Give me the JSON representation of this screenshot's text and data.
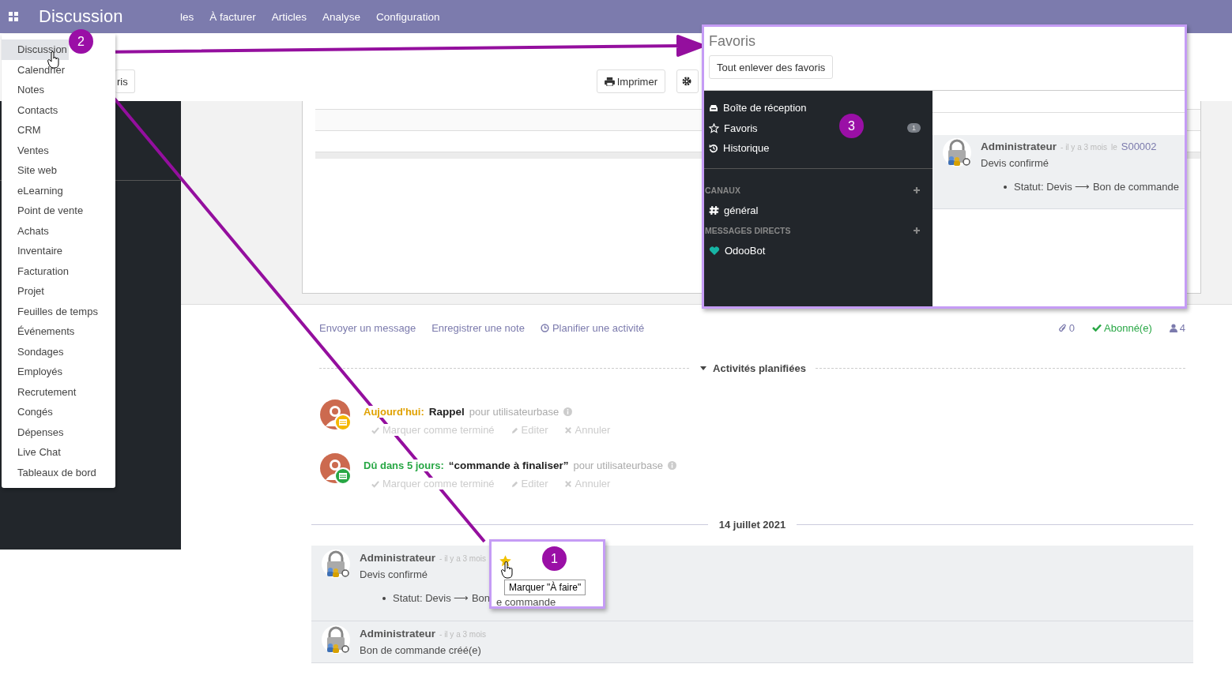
{
  "navbar": {
    "title": "Discussion",
    "menu": [
      "les",
      "À facturer",
      "Articles",
      "Analyse",
      "Configuration"
    ]
  },
  "control_panel": {
    "buttons": [
      {
        "kind": "plain",
        "label": "ris"
      },
      {
        "kind": "print",
        "label": "Imprimer"
      },
      {
        "kind": "gear"
      }
    ]
  },
  "app_menu": {
    "items": [
      {
        "label": "Discussion",
        "selected": true
      },
      {
        "label": "Calendrier",
        "selected": false
      },
      {
        "label": "Notes",
        "selected": false
      },
      {
        "label": "Contacts",
        "selected": false
      },
      {
        "label": "CRM",
        "selected": false
      },
      {
        "label": "Ventes",
        "selected": false
      },
      {
        "label": "Site web",
        "selected": false
      },
      {
        "label": "eLearning",
        "selected": false
      },
      {
        "label": "Point de vente",
        "selected": false
      },
      {
        "label": "Achats",
        "selected": false
      },
      {
        "label": "Inventaire",
        "selected": false
      },
      {
        "label": "Facturation",
        "selected": false
      },
      {
        "label": "Projet",
        "selected": false
      },
      {
        "label": "Feuilles de temps",
        "selected": false
      },
      {
        "label": "Événements",
        "selected": false
      },
      {
        "label": "Sondages",
        "selected": false
      },
      {
        "label": "Employés",
        "selected": false
      },
      {
        "label": "Recrutement",
        "selected": false
      },
      {
        "label": "Congés",
        "selected": false
      },
      {
        "label": "Dépenses",
        "selected": false
      },
      {
        "label": "Live Chat",
        "selected": false
      },
      {
        "label": "Tableaux de bord",
        "selected": false
      }
    ]
  },
  "chatter": {
    "actions": [
      {
        "kind": "link",
        "label": "Envoyer un message"
      },
      {
        "kind": "link",
        "label": "Enregistrer une note"
      },
      {
        "kind": "clock",
        "label": "Planifier une activité"
      }
    ],
    "attachments": "0",
    "follow": "Abonné(e)",
    "followers": "4",
    "activities_title": "Activités planifiées",
    "activities": [
      {
        "kind": "today",
        "due": "Aujourd'hui:",
        "summary": "Rappel",
        "assignee": "pour utilisateurbase",
        "actions": [
          "Marquer comme terminé",
          "Editer",
          "Annuler"
        ]
      },
      {
        "kind": "planned",
        "due": "Dû dans 5 jours:",
        "summary": "“commande à finaliser”",
        "assignee": "pour utilisateurbase",
        "actions": [
          "Marquer comme terminé",
          "Editer",
          "Annuler"
        ]
      }
    ],
    "date_separator": "14 juillet 2021",
    "messages": [
      {
        "author": "Administrateur",
        "time": "- il y a 3 mois",
        "body": "Devis confirmé",
        "tracking": "Statut: Devis ⟶ Bon"
      },
      {
        "author": "Administrateur",
        "time": "- il y a 3 mois",
        "body": "Bon de commande créé(e)"
      }
    ]
  },
  "favorites_inset": {
    "title": "Favoris",
    "button": "Tout enlever des favoris",
    "mailboxes": [
      {
        "kind": "inbox",
        "label": "Boîte de réception",
        "selected": false
      },
      {
        "kind": "star",
        "label": "Favoris",
        "counter": "1",
        "selected": false
      },
      {
        "kind": "history",
        "label": "Historique",
        "selected": false
      }
    ],
    "channels_title": "CANAUX",
    "channels": [
      {
        "kind": "hash",
        "label": "général"
      }
    ],
    "direct_title": "MESSAGES DIRECTS",
    "direct": [
      {
        "kind": "heart",
        "label": "OdooBot"
      }
    ],
    "message": {
      "author": "Administrateur",
      "time": "- il y a 3 mois",
      "prep": "le",
      "record": "S00002",
      "body": "Devis confirmé",
      "tracking": "Statut: Devis ⟶ Bon de commande"
    }
  },
  "tooltip": "Marquer \"À faire\"",
  "inset_fragment": "e commande",
  "callouts": [
    "1",
    "2",
    "3"
  ]
}
